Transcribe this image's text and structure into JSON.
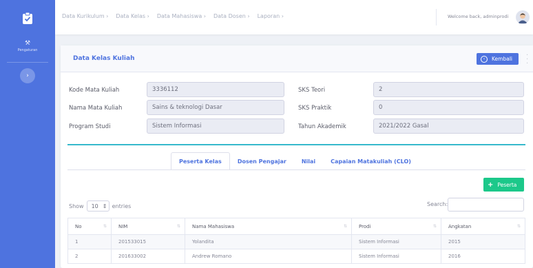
{
  "sidebar": {
    "items": [
      {
        "label": "Pengaturan",
        "icon": "settings-icon"
      }
    ],
    "toggle_icon": "chevron-right-icon",
    "color": "#4e73df"
  },
  "topbar": {
    "breadcrumbs": [
      "Data Kurikulum ›",
      "Data Kelas ›",
      "Data Mahasiswa ›",
      "Data Dosen ›",
      "Laporan ›"
    ],
    "welcome": "Welcome back, adminprodi"
  },
  "card": {
    "title": "Data Kelas Kuliah",
    "back_button": "Kembali"
  },
  "fields": {
    "kode": {
      "label": "Kode Mata Kuliah",
      "value": "3336112"
    },
    "nama": {
      "label": "Nama Mata Kuliah",
      "value": "Sains & teknologi Dasar"
    },
    "prodi": {
      "label": "Program Studi",
      "value": "Sistem Informasi"
    },
    "sks_teori": {
      "label": "SKS Teori",
      "value": "2"
    },
    "sks_praktik": {
      "label": "SKS Praktik",
      "value": "0"
    },
    "tahun": {
      "label": "Tahun Akademik",
      "value": "2021/2022 Gasal"
    }
  },
  "tabs": [
    "Peserta Kelas",
    "Dosen Pengajar",
    "Nilai",
    "Capaian Matakuliah (CLO)"
  ],
  "active_tab": "Peserta Kelas",
  "add_button": "Peserta",
  "table_controls": {
    "show_label": "Show",
    "page_size": "10",
    "entries_label": "entries",
    "search_label": "Search:"
  },
  "table": {
    "headers": [
      "No",
      "NIM",
      "Nama Mahasiswa",
      "Prodi",
      "Angkatan"
    ],
    "rows": [
      [
        "1",
        "201533015",
        "Yolandita",
        "Sistem Informasi",
        "2015"
      ],
      [
        "2",
        "201633002",
        "Andrew Romano",
        "Sistem Informasi",
        "2016"
      ]
    ]
  },
  "colors": {
    "primary": "#4e73df",
    "success": "#1cc88a",
    "info": "#36b9cc"
  }
}
